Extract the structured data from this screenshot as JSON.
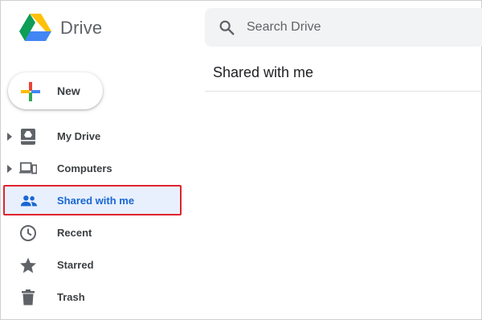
{
  "header": {
    "app_title": "Drive",
    "search": {
      "placeholder": "Search Drive",
      "value": ""
    }
  },
  "new_button": {
    "label": "New"
  },
  "sidebar": {
    "items": [
      {
        "label": "My Drive",
        "icon": "my-drive-icon",
        "expandable": true
      },
      {
        "label": "Computers",
        "icon": "computers-icon",
        "expandable": true
      },
      {
        "label": "Shared with me",
        "icon": "people-icon",
        "selected": true
      },
      {
        "label": "Recent",
        "icon": "clock-icon"
      },
      {
        "label": "Starred",
        "icon": "star-icon"
      },
      {
        "label": "Trash",
        "icon": "trash-icon"
      }
    ]
  },
  "main": {
    "title": "Shared with me"
  },
  "colors": {
    "selected_bg": "#e8f0fe",
    "selected_text": "#1967d2",
    "highlight_border": "#e0232f",
    "icon": "#5f6368",
    "text": "#3c4043"
  }
}
